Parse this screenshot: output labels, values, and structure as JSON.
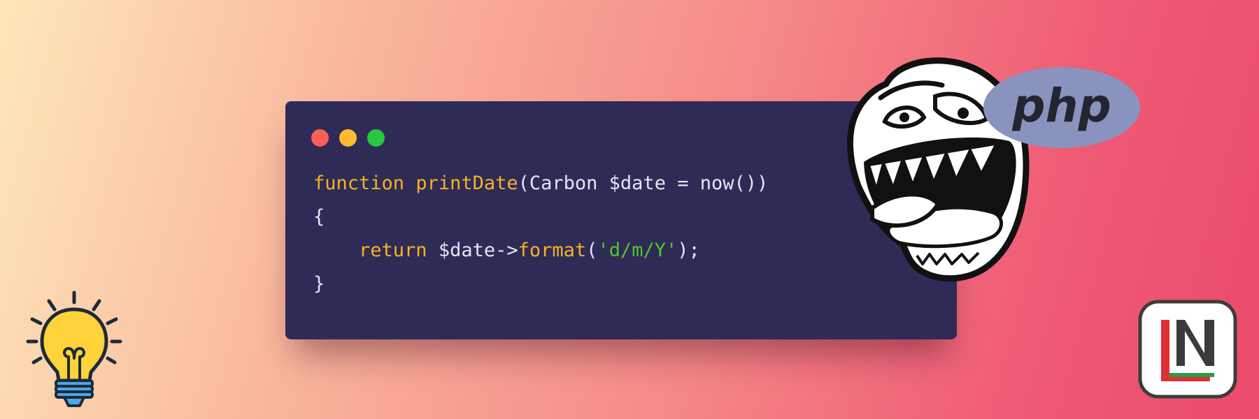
{
  "window": {
    "controls": [
      "close",
      "minimize",
      "maximize"
    ],
    "colors": {
      "background": "#2e2b57",
      "close": "#fd5f57",
      "minimize": "#febc2e",
      "maximize": "#28c840"
    }
  },
  "code": {
    "line1": {
      "keyword": "function",
      "function_name": "printDate",
      "params": "(Carbon $date = now())"
    },
    "line2": "{",
    "line3": {
      "indent": "    ",
      "keyword": "return",
      "variable": " $date->",
      "method": "format",
      "open": "(",
      "string": "'d/m/Y'",
      "close": ");"
    },
    "line4": "}",
    "colors": {
      "keyword": "#f6b321",
      "string": "#4fc72c",
      "text": "#e7e4f5"
    }
  },
  "logos": {
    "php": {
      "text": "php",
      "color": "#8993be"
    },
    "troll_face": {
      "icon": "troll-face-icon"
    },
    "lightbulb": {
      "icon": "lightbulb-icon",
      "color": "#fdd33a"
    },
    "laravel_news": {
      "icon": "laravel-news-logo",
      "colors": [
        "#e12f36",
        "#3b3b3b",
        "#2c9a4b"
      ]
    }
  }
}
